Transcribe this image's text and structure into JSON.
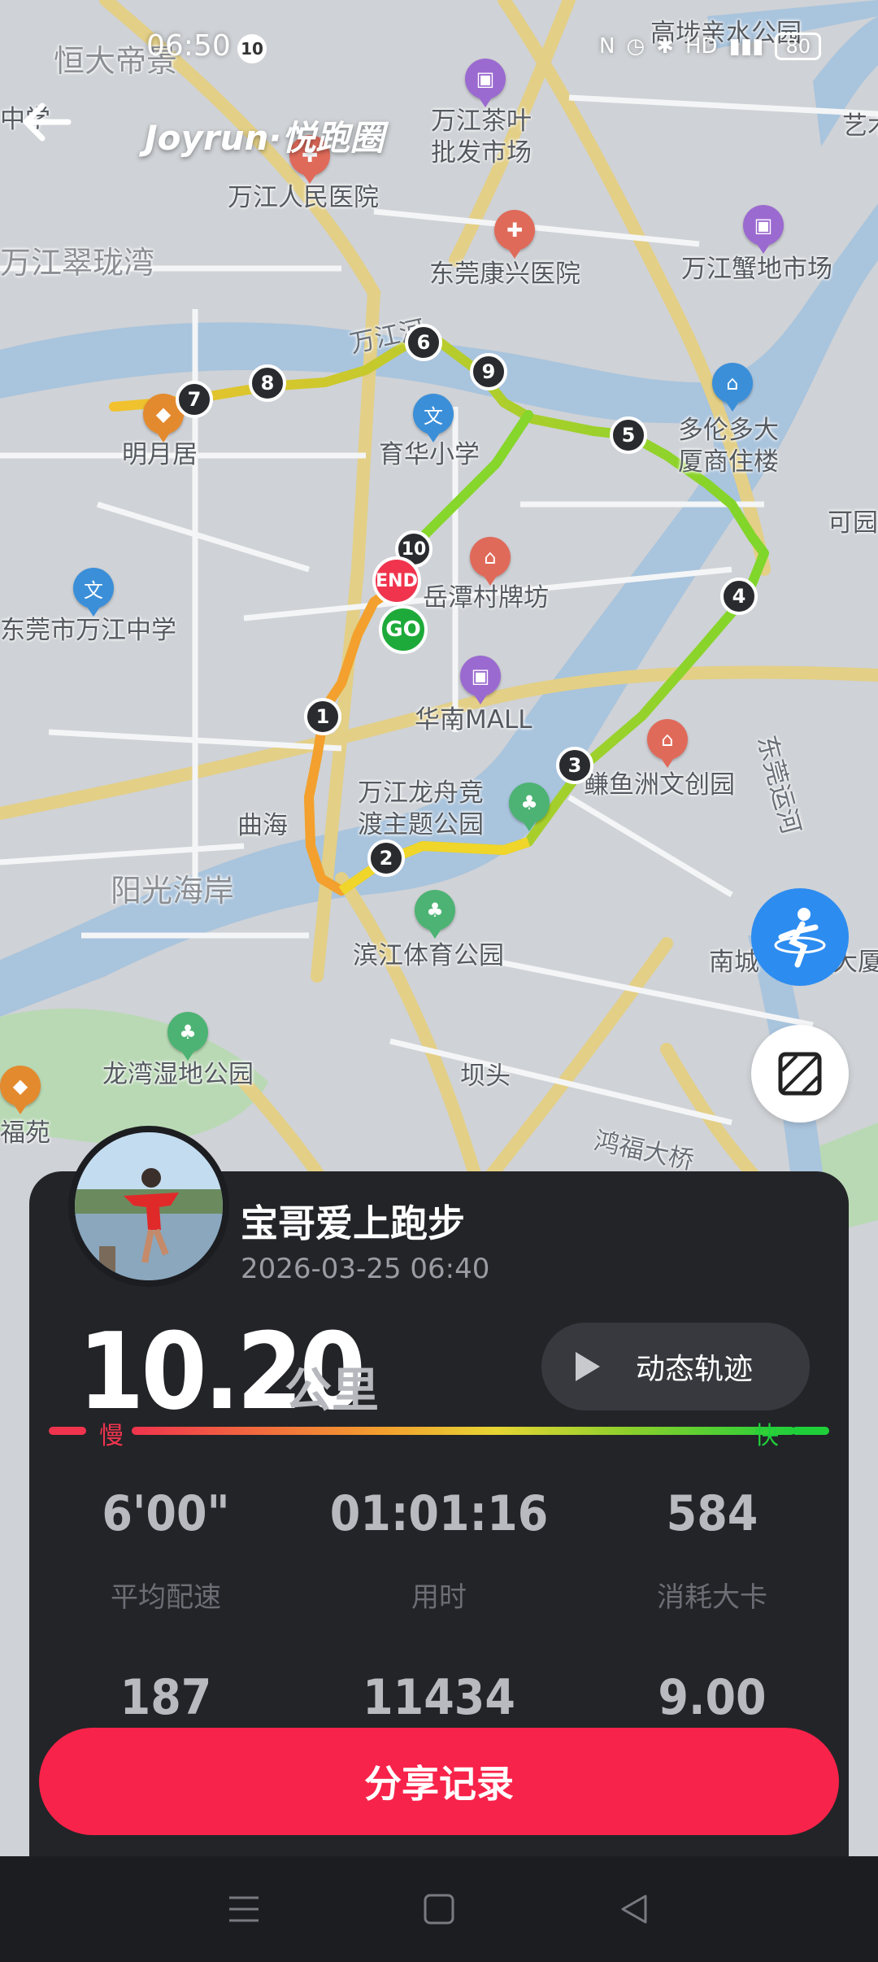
{
  "status_bar": {
    "time": "06:50",
    "notification_count": "10",
    "battery": "80",
    "network": "HD"
  },
  "header": {
    "brand": "Joyrun·悦跑圈"
  },
  "map": {
    "labels": [
      {
        "text": "恒大帝景",
        "cls": "big"
      },
      {
        "text": "万江茶叶\n批发市场",
        "cls": ""
      },
      {
        "text": "万江人民医院",
        "cls": ""
      },
      {
        "text": "东莞康兴医院",
        "cls": ""
      },
      {
        "text": "万江蟹地市场",
        "cls": ""
      },
      {
        "text": "万江翠珑湾",
        "cls": "big"
      },
      {
        "text": "高埗亲水公园",
        "cls": ""
      },
      {
        "text": "明月居",
        "cls": ""
      },
      {
        "text": "育华小学",
        "cls": ""
      },
      {
        "text": "多伦多大\n厦商住楼",
        "cls": ""
      },
      {
        "text": "岳潭村牌坊",
        "cls": ""
      },
      {
        "text": "东莞市万江中学",
        "cls": ""
      },
      {
        "text": "华南MALL",
        "cls": ""
      },
      {
        "text": "万江龙舟竞\n渡主题公园",
        "cls": ""
      },
      {
        "text": "鳒鱼洲文创园",
        "cls": ""
      },
      {
        "text": "曲海",
        "cls": ""
      },
      {
        "text": "阳光海岸",
        "cls": "big"
      },
      {
        "text": "滨江体育公园",
        "cls": ""
      },
      {
        "text": "龙湾湿地公园",
        "cls": ""
      },
      {
        "text": "坝头",
        "cls": ""
      },
      {
        "text": "福苑",
        "cls": ""
      },
      {
        "text": "鸿福大桥",
        "cls": "road"
      },
      {
        "text": "东莞运河",
        "cls": "road"
      },
      {
        "text": "万江河",
        "cls": "road"
      },
      {
        "text": "南城",
        "cls": ""
      },
      {
        "text": "可园",
        "cls": ""
      },
      {
        "text": "艺术",
        "cls": ""
      },
      {
        "text": "中学",
        "cls": ""
      },
      {
        "text": "大厦",
        "cls": ""
      }
    ],
    "km_markers": [
      "1",
      "2",
      "3",
      "4",
      "5",
      "6",
      "7",
      "8",
      "9",
      "10"
    ],
    "start_label": "GO",
    "end_label": "END"
  },
  "user": {
    "name": "宝哥爱上跑步",
    "datetime": "2026-03-25 06:40"
  },
  "summary": {
    "distance": "10.20",
    "distance_unit": "公里",
    "replay_label": "动态轨迹",
    "pace_slow": "慢",
    "pace_fast": "快"
  },
  "stats": [
    {
      "value": "6'00\"",
      "label": "平均配速"
    },
    {
      "value": "01:01:16",
      "label": "用时"
    },
    {
      "value": "584",
      "label": "消耗大卡"
    },
    {
      "value": "187",
      "label": ""
    },
    {
      "value": "11434",
      "label": ""
    },
    {
      "value": "9.00",
      "label": ""
    }
  ],
  "actions": {
    "share_label": "分享记录"
  },
  "colors": {
    "accent": "#f8234a",
    "card": "#232428",
    "route_start": "#f3a02e",
    "route_fast": "#1fcf3a"
  }
}
